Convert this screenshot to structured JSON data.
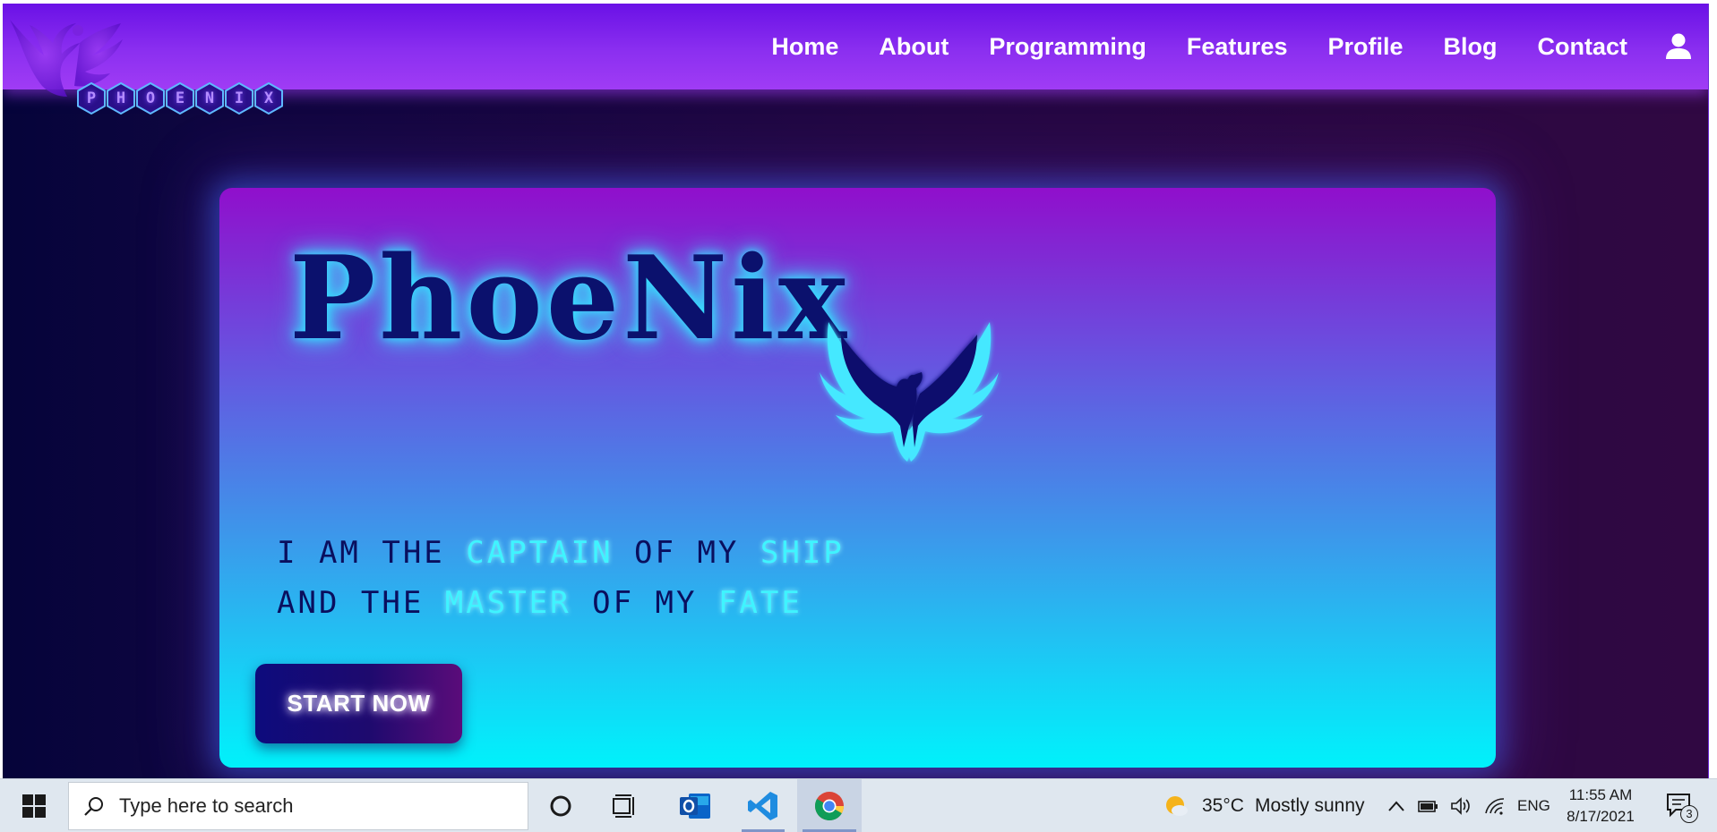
{
  "brand": {
    "logo_letters": [
      "P",
      "H",
      "O",
      "E",
      "N",
      "I",
      "X"
    ],
    "accent_color": "#a03cf5",
    "glow_color": "#35e3ff"
  },
  "nav": {
    "items": [
      {
        "label": "Home"
      },
      {
        "label": "About"
      },
      {
        "label": "Programming"
      },
      {
        "label": "Features"
      },
      {
        "label": "Profile"
      },
      {
        "label": "Blog"
      },
      {
        "label": "Contact"
      }
    ],
    "user_icon": "user-icon"
  },
  "hero": {
    "title": "PhoeNix",
    "tagline_line1": {
      "w1": "I AM THE",
      "h1": "CAPTAIN",
      "w2": "OF MY",
      "h2": "SHIP"
    },
    "tagline_line2": {
      "w1": "AND THE",
      "h1": "MASTER",
      "w2": "OF MY",
      "h2": "FATE"
    },
    "cta_label": "START NOW"
  },
  "taskbar": {
    "search_placeholder": "Type here to search",
    "weather_temp": "35°C",
    "weather_desc": "Mostly sunny",
    "language": "ENG",
    "time": "11:55 AM",
    "date": "8/17/2021",
    "notification_count": "3",
    "apps": [
      "cortana-icon",
      "task-view-icon",
      "outlook-icon",
      "vscode-icon",
      "chrome-icon"
    ]
  }
}
